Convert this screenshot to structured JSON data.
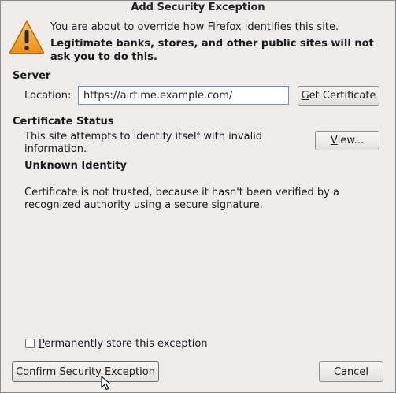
{
  "dialog": {
    "title": "Add Security Exception",
    "intro": "You are about to override how Firefox identifies this site.",
    "warning_line1": "Legitimate banks, stores, and other public sites will not",
    "warning_line2": "ask you to do this."
  },
  "server": {
    "heading": "Server",
    "location_label": "Location:",
    "location_value": "https://airtime.example.com/",
    "get_cert_label_mnemonic": "G",
    "get_cert_label_rest": "et Certificate"
  },
  "cert_status": {
    "heading": "Certificate Status",
    "desc_line1": "This site attempts to identify itself with invalid",
    "desc_line2": "information.",
    "view_label_mnemonic": "V",
    "view_label_rest": "iew...",
    "identity_heading": "Unknown Identity",
    "identity_line1": "Certificate is not trusted, because it hasn't been verified by a",
    "identity_line2": "recognized authority using a secure signature."
  },
  "footer": {
    "permanent_mnemonic": "P",
    "permanent_rest": "ermanently store this exception",
    "permanent_checked": false,
    "confirm_mnemonic": "C",
    "confirm_rest": "onfirm Security Exception",
    "cancel_label": "Cancel"
  },
  "colors": {
    "warning_fill": "#f0a236",
    "warning_stroke": "#b86a0a",
    "background": "#edeceb"
  },
  "icons": {
    "warning": "warning-triangle-icon",
    "cursor": "mouse-pointer-icon"
  }
}
